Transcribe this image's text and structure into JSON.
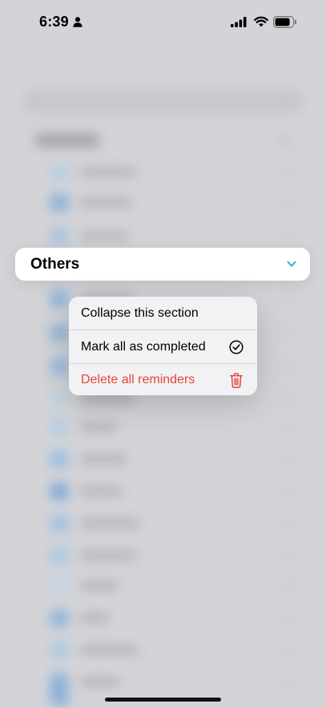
{
  "status_bar": {
    "time": "6:39"
  },
  "section": {
    "title": "Others"
  },
  "menu": {
    "items": [
      {
        "label": "Collapse this section",
        "icon": null
      },
      {
        "label": "Mark all as completed",
        "icon": "checkmark-circle-icon"
      },
      {
        "label": "Delete all reminders",
        "icon": "trash-icon",
        "destructive": true
      }
    ]
  },
  "colors": {
    "accent": "#30A9DE",
    "destructive": "#E5453B",
    "menu_background": "#F2F2F4",
    "backdrop": "#D4D4D8"
  }
}
